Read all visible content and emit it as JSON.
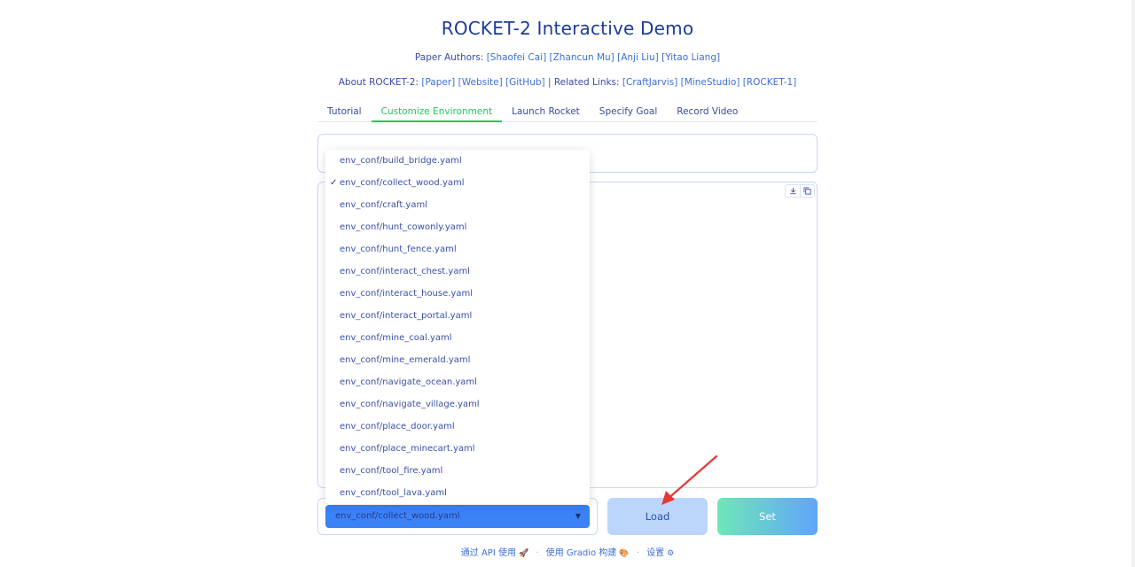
{
  "header": {
    "title": "ROCKET-2 Interactive Demo",
    "authors_prefix": "Paper Authors:",
    "authors": [
      "[Shaofei Cai]",
      "[Zhancun Mu]",
      "[Anji Liu]",
      "[Yitao Liang]"
    ],
    "about_prefix": "About ROCKET-2:",
    "about_links": [
      "[Paper]",
      "[Website]",
      "[GitHub]"
    ],
    "related_prefix": "| Related Links:",
    "related_links": [
      "[CraftJarvis]",
      "[MineStudio]",
      "[ROCKET-1]"
    ]
  },
  "tabs": [
    {
      "label": "Tutorial",
      "active": false
    },
    {
      "label": "Customize Environment",
      "active": true
    },
    {
      "label": "Launch Rocket",
      "active": false
    },
    {
      "label": "Specify Goal",
      "active": false
    },
    {
      "label": "Record Video",
      "active": false
    }
  ],
  "code_tools": {
    "download_icon": "download-icon",
    "copy_icon": "copy-icon"
  },
  "dropdown": {
    "selected_index": 1,
    "check_mark": "✓",
    "options": [
      "env_conf/build_bridge.yaml",
      "env_conf/collect_wood.yaml",
      "env_conf/craft.yaml",
      "env_conf/hunt_cowonly.yaml",
      "env_conf/hunt_fence.yaml",
      "env_conf/interact_chest.yaml",
      "env_conf/interact_house.yaml",
      "env_conf/interact_portal.yaml",
      "env_conf/mine_coal.yaml",
      "env_conf/mine_emerald.yaml",
      "env_conf/navigate_ocean.yaml",
      "env_conf/navigate_village.yaml",
      "env_conf/place_door.yaml",
      "env_conf/place_minecart.yaml",
      "env_conf/tool_fire.yaml",
      "env_conf/tool_lava.yaml"
    ]
  },
  "select": {
    "value": "env_conf/collect_wood.yaml",
    "caret": "▼"
  },
  "buttons": {
    "load": "Load",
    "set": "Set"
  },
  "footer": {
    "api": "通过 API 使用",
    "api_emoji": "🚀",
    "gradio": "使用 Gradio 构建",
    "gradio_emoji": "🎨",
    "settings": "设置",
    "settings_emoji": "⚙",
    "sep": "·"
  },
  "colors": {
    "accent_green": "#22c55e",
    "select_blue": "#3b82f6",
    "load_bg": "#bcd6fb",
    "annotation_red": "#e53935"
  }
}
